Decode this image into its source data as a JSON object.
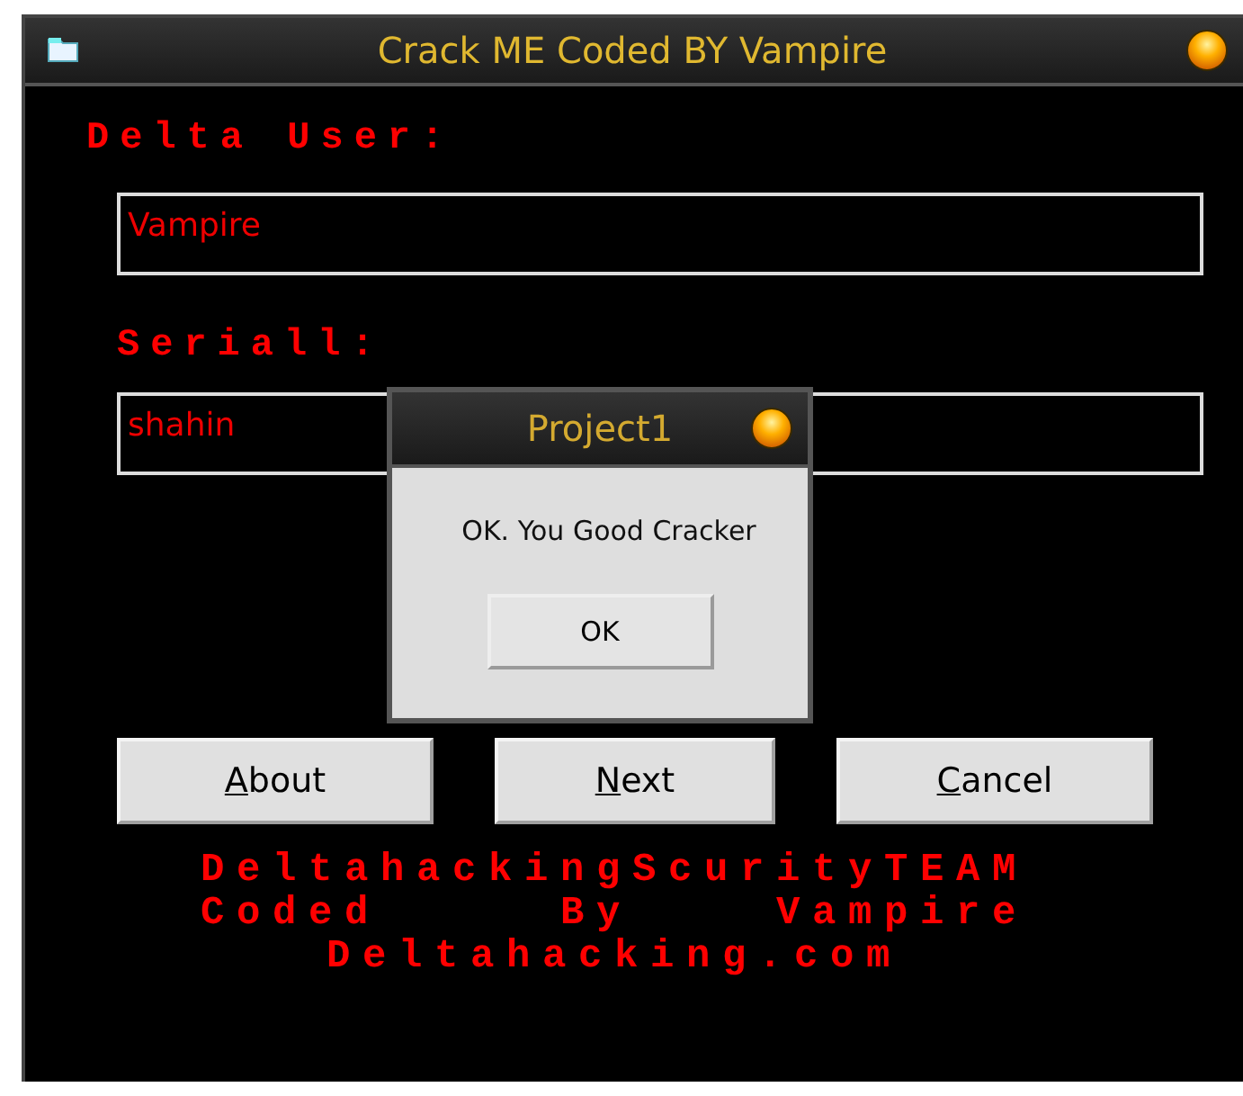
{
  "window": {
    "title": "Crack ME Coded BY Vampire"
  },
  "fields": [
    {
      "label": "Delta User:",
      "value": "Vampire"
    },
    {
      "label": "Seriall:",
      "value": "shahin"
    }
  ],
  "buttons": [
    "About",
    "Next",
    "Cancel"
  ],
  "credits": [
    "DeltahackingScurityTEAM",
    "Coded     By    Vampire",
    "Deltahacking.com"
  ],
  "dialog": {
    "title": "Project1",
    "message": "OK. You Good Cracker",
    "button": "OK"
  }
}
